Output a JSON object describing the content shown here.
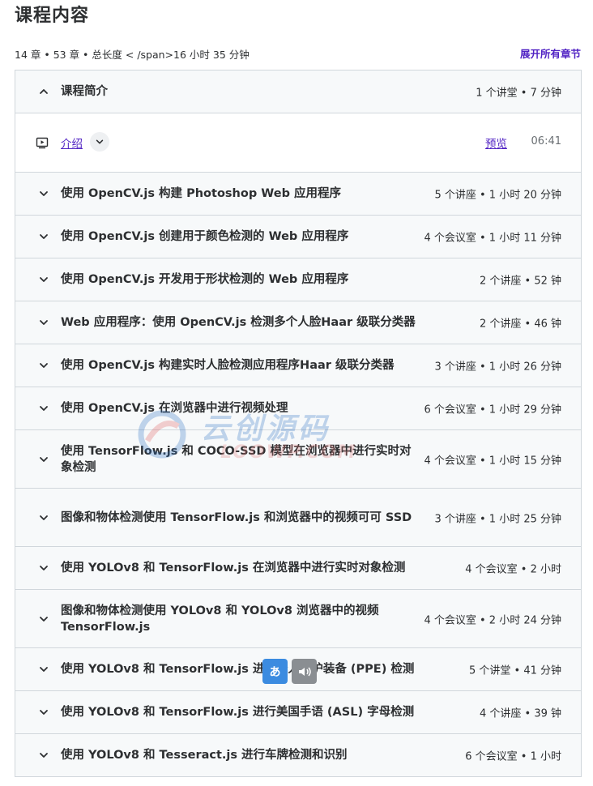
{
  "page": {
    "title": "课程内容"
  },
  "summary": {
    "text": "14 章 • 53 章 • 总长度 < /span>16 小时 35 分钟",
    "expand_all": "展开所有章节"
  },
  "sections": [
    {
      "title": "课程简介",
      "meta": "1 个讲堂 • 7 分钟",
      "expanded": true,
      "lectures": [
        {
          "title": "介绍",
          "preview": "预览",
          "duration": "06:41"
        }
      ]
    },
    {
      "title": "使用 OpenCV.js 构建 Photoshop Web 应用程序",
      "meta": "5 个讲座 • 1 小时 20 分钟"
    },
    {
      "title": "使用 OpenCV.js 创建用于颜色检测的 Web 应用程序",
      "meta": "4 个会议室 • 1 小时 11 分钟"
    },
    {
      "title": "使用 OpenCV.js 开发用于形状检测的 Web 应用程序",
      "meta": "2 个讲座 • 52 钟"
    },
    {
      "title": "Web 应用程序：使用 OpenCV.js 检测多个人脸Haar 级联分类器",
      "meta": "2 个讲座 • 46 钟"
    },
    {
      "title": "使用 OpenCV.js 构建实时人脸检测应用程序Haar 级联分类器",
      "meta": "3 个讲座 • 1 小时 26 分钟"
    },
    {
      "title": "使用 OpenCV.js 在浏览器中进行视频处理",
      "meta": "6 个会议室 • 1 小时 29 分钟"
    },
    {
      "title": "使用 TensorFlow.js 和 COCO-SSD 模型在浏览器中进行实时对象检测",
      "meta": "4 个会议室 • 1 小时 15 分钟",
      "tall": true
    },
    {
      "title": "图像和物体检测使用 TensorFlow.js 和浏览器中的视频可可 SSD",
      "meta": "3 个讲座 • 1 小时 25 分钟",
      "tall": true
    },
    {
      "title": "使用 YOLOv8 和 TensorFlow.js 在浏览器中进行实时对象检测",
      "meta": "4 个会议室 • 2 小时"
    },
    {
      "title": "图像和物体检测使用 YOLOv8 和 YOLOv8 浏览器中的视频 TensorFlow.js",
      "meta": "4 个会议室 • 2 小时 24 分钟",
      "tall": true
    },
    {
      "title": "使用 YOLOv8 和 TensorFlow.js 进行个人防护装备 (PPE) 检测",
      "meta": "5 个讲堂 • 41 分钟"
    },
    {
      "title": "使用 YOLOv8 和 TensorFlow.js 进行美国手语 (ASL) 字母检测",
      "meta": "4 个讲座 • 39 钟"
    },
    {
      "title": "使用 YOLOv8 和 Tesseract.js 进行车牌检测和识别",
      "meta": "6 个会议室 • 1 小时"
    }
  ],
  "watermark": {
    "cn": "云创源码",
    "en": "LOOWP.COM"
  },
  "overlay": {
    "translate_glyph": "あ",
    "translate_color": "#3b8be0",
    "speak_icon": "speaker-icon"
  },
  "colors": {
    "accent": "#5022c3",
    "section_bg": "#f7f9fa",
    "border": "#d1d7dc",
    "text": "#2d2f31"
  }
}
